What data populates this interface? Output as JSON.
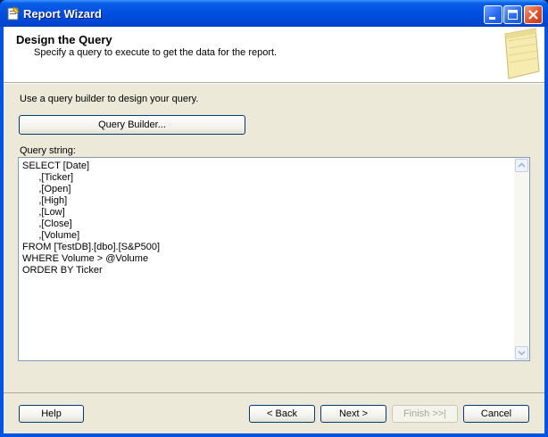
{
  "window": {
    "title": "Report Wizard"
  },
  "header": {
    "title": "Design the Query",
    "subtitle": "Specify a query to execute to get the data for the report."
  },
  "main": {
    "instruction": "Use a query builder to design your query.",
    "query_builder_label": "Query Builder...",
    "query_string_label": "Query string:",
    "query_string": "SELECT [Date]\n      ,[Ticker]\n      ,[Open]\n      ,[High]\n      ,[Low]\n      ,[Close]\n      ,[Volume]\nFROM [TestDB].[dbo].[S&P500]\nWHERE Volume > @Volume\nORDER BY Ticker"
  },
  "footer": {
    "help_label": "Help",
    "back_label": "< Back",
    "next_label": "Next >",
    "finish_label": "Finish >>|",
    "cancel_label": "Cancel"
  },
  "icons": {
    "app": "report-wizard-icon",
    "minimize": "minimize-icon",
    "maximize": "maximize-icon",
    "close": "close-icon",
    "header_art": "notepad-icon",
    "scroll_up": "chevron-up-icon",
    "scroll_down": "chevron-down-icon"
  },
  "colors": {
    "titlebar": "#0050e0",
    "dialog_bg": "#ece9d8",
    "close_button": "#e0542c",
    "button_border": "#003c74"
  }
}
